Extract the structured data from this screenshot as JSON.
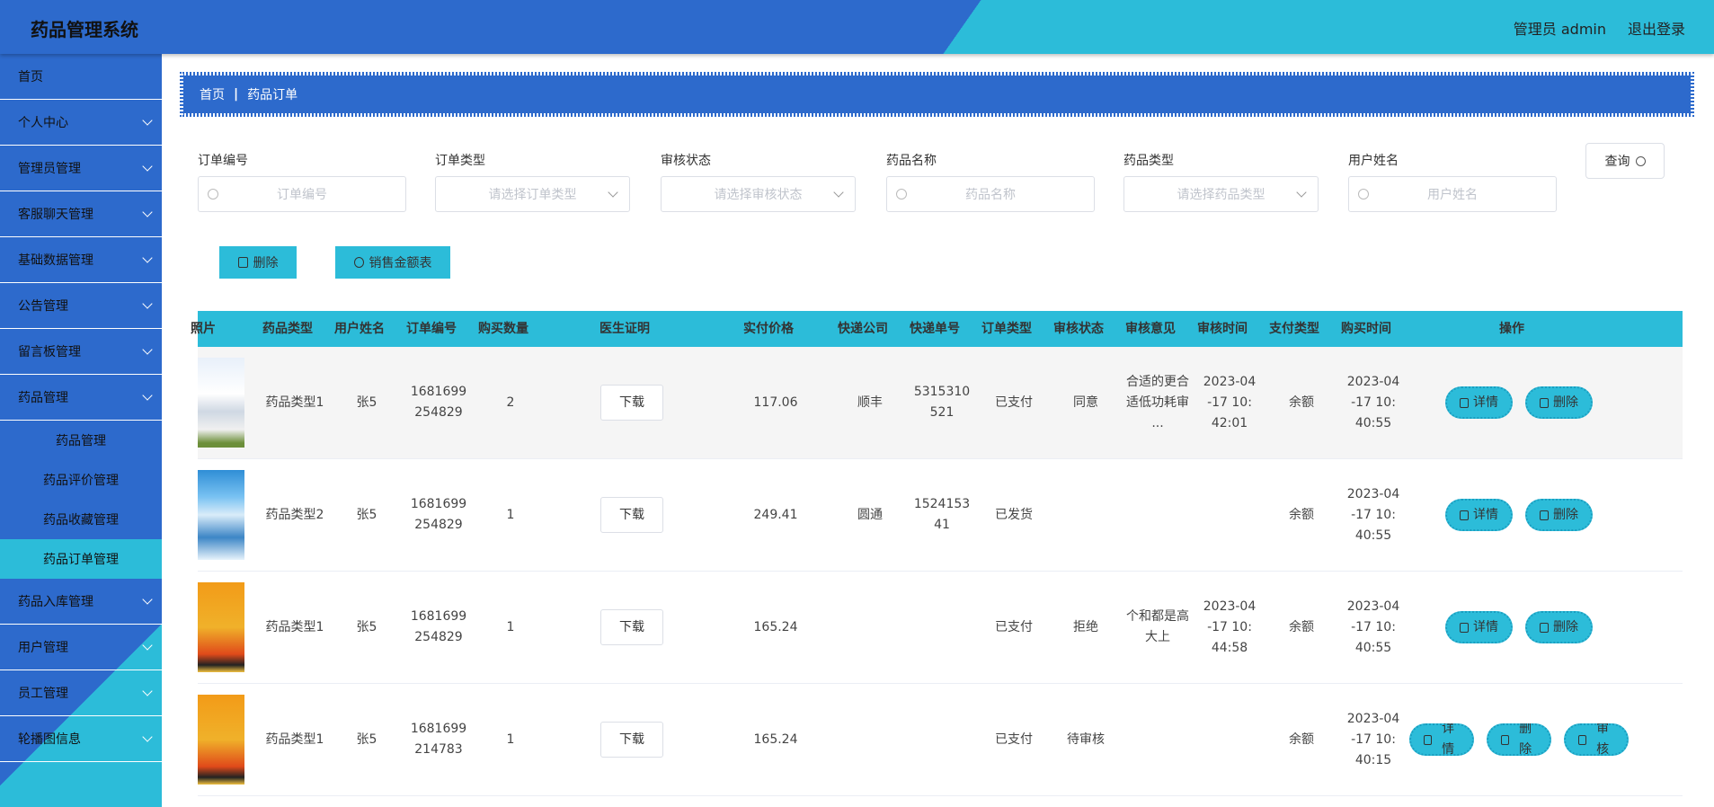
{
  "header": {
    "brand": "药品管理系统",
    "user": "管理员 admin",
    "logout": "退出登录"
  },
  "sidebar": {
    "items": [
      {
        "label": "首页",
        "chevron": false
      },
      {
        "label": "个人中心",
        "chevron": true
      },
      {
        "label": "管理员管理",
        "chevron": true
      },
      {
        "label": "客服聊天管理",
        "chevron": true
      },
      {
        "label": "基础数据管理",
        "chevron": true
      },
      {
        "label": "公告管理",
        "chevron": true
      },
      {
        "label": "留言板管理",
        "chevron": true
      },
      {
        "label": "药品管理",
        "chevron": true
      }
    ],
    "subitems": [
      "药品管理",
      "药品评价管理",
      "药品收藏管理",
      "药品订单管理"
    ],
    "items_after": [
      "药品入库管理",
      "用户管理",
      "员工管理",
      "轮播图信息"
    ]
  },
  "breadcrumb": {
    "home": "首页",
    "sep": "|",
    "current": "药品订单"
  },
  "filters": {
    "order_no": {
      "label": "订单编号",
      "placeholder": "订单编号"
    },
    "order_type": {
      "label": "订单类型",
      "placeholder": "请选择订单类型"
    },
    "audit_status": {
      "label": "审核状态",
      "placeholder": "请选择审核状态"
    },
    "drug_name": {
      "label": "药品名称",
      "placeholder": "药品名称"
    },
    "drug_type": {
      "label": "药品类型",
      "placeholder": "请选择药品类型"
    },
    "user_name": {
      "label": "用户姓名",
      "placeholder": "用户姓名"
    },
    "query": "查询"
  },
  "actions": {
    "delete": "删除",
    "sales_chart": "销售金额表"
  },
  "table": {
    "headers": [
      "照片",
      "药品类型",
      "用户姓名",
      "订单编号",
      "购买数量",
      "医生证明",
      "实付价格",
      "快递公司",
      "快递单号",
      "订单类型",
      "审核状态",
      "审核意见",
      "审核时间",
      "支付类型",
      "购买时间",
      "操作"
    ],
    "rows": [
      {
        "thumb": "t1",
        "type": "药品类型1",
        "user": "张5",
        "order": "1681699254829",
        "qty": "2",
        "cert": "下载",
        "price": "117.06",
        "courier": "顺丰",
        "tracking": "5315310521",
        "otype": "已支付",
        "status": "同意",
        "opinion": "合适的更合适低功耗审...",
        "atime": "2023-04-17 10:42:01",
        "pay": "余额",
        "btime": "2023-04-17 10:40:55",
        "ops": [
          "详情",
          "删除"
        ]
      },
      {
        "thumb": "t2",
        "type": "药品类型2",
        "user": "张5",
        "order": "1681699254829",
        "qty": "1",
        "cert": "下载",
        "price": "249.41",
        "courier": "圆通",
        "tracking": "152415341",
        "otype": "已发货",
        "status": "",
        "opinion": "",
        "atime": "",
        "pay": "余额",
        "btime": "2023-04-17 10:40:55",
        "ops": [
          "详情",
          "删除"
        ]
      },
      {
        "thumb": "t3",
        "type": "药品类型1",
        "user": "张5",
        "order": "1681699254829",
        "qty": "1",
        "cert": "下载",
        "price": "165.24",
        "courier": "",
        "tracking": "",
        "otype": "已支付",
        "status": "拒绝",
        "opinion": "个和都是高大上",
        "atime": "2023-04-17 10:44:58",
        "pay": "余额",
        "btime": "2023-04-17 10:40:55",
        "ops": [
          "详情",
          "删除"
        ]
      },
      {
        "thumb": "t3",
        "type": "药品类型1",
        "user": "张5",
        "order": "1681699214783",
        "qty": "1",
        "cert": "下载",
        "price": "165.24",
        "courier": "",
        "tracking": "",
        "otype": "已支付",
        "status": "待审核",
        "opinion": "",
        "atime": "",
        "pay": "余额",
        "btime": "2023-04-17 10:40:15",
        "ops": [
          "详情",
          "删除",
          "审核"
        ]
      }
    ]
  },
  "colors": {
    "primary": "#2d6acc",
    "accent": "#2cbcd9"
  }
}
